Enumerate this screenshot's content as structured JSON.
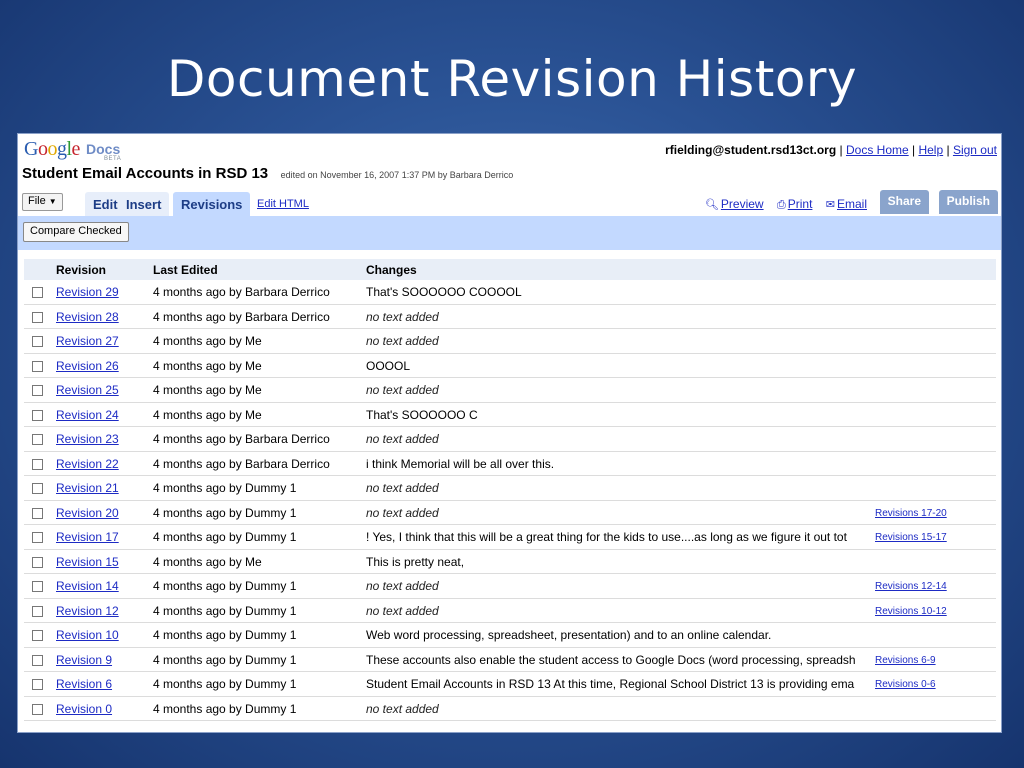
{
  "slide": {
    "title": "Document Revision History"
  },
  "app": {
    "logo_text": "Google",
    "logo_sub": "Docs",
    "logo_beta": "BETA",
    "account_email": "rfielding@student.rsd13ct.org",
    "links": [
      "Docs Home",
      "Help",
      "Sign out"
    ]
  },
  "document": {
    "title": "Student Email Accounts in RSD 13",
    "edited": "edited on November 16, 2007 1:37 PM by Barbara Derrico"
  },
  "tabs": {
    "file": "File",
    "edit": "Edit",
    "insert": "Insert",
    "revisions": "Revisions",
    "edit_html": "Edit HTML",
    "preview": "Preview",
    "print": "Print",
    "email": "Email",
    "share": "Share",
    "publish": "Publish"
  },
  "toolbar": {
    "compare": "Compare Checked"
  },
  "table": {
    "headers": [
      "Revision",
      "Last Edited",
      "Changes"
    ],
    "rows": [
      {
        "revision": "Revision 29",
        "edited": "4 months ago by Barbara Derrico",
        "changes": "That's SOOOOOO COOOOL",
        "range": ""
      },
      {
        "revision": "Revision 28",
        "edited": "4 months ago by Barbara Derrico",
        "changes": "no text added",
        "range": ""
      },
      {
        "revision": "Revision 27",
        "edited": "4 months ago by Me",
        "changes": "no text added",
        "range": ""
      },
      {
        "revision": "Revision 26",
        "edited": "4 months ago by Me",
        "changes": "OOOOL",
        "range": ""
      },
      {
        "revision": "Revision 25",
        "edited": "4 months ago by Me",
        "changes": "no text added",
        "range": ""
      },
      {
        "revision": "Revision 24",
        "edited": "4 months ago by Me",
        "changes": "That's SOOOOOO C",
        "range": ""
      },
      {
        "revision": "Revision 23",
        "edited": "4 months ago by Barbara Derrico",
        "changes": "no text added",
        "range": ""
      },
      {
        "revision": "Revision 22",
        "edited": "4 months ago by Barbara Derrico",
        "changes": "i think Memorial will be all over this.",
        "range": ""
      },
      {
        "revision": "Revision 21",
        "edited": "4 months ago by Dummy 1",
        "changes": "no text added",
        "range": ""
      },
      {
        "revision": "Revision 20",
        "edited": "4 months ago by Dummy 1",
        "changes": "no text added",
        "range": "Revisions 17-20"
      },
      {
        "revision": "Revision 17",
        "edited": "4 months ago by Dummy 1",
        "changes": "! Yes, I think that this will be a great thing for the kids to use....as long as we figure it out tot",
        "range": "Revisions 15-17"
      },
      {
        "revision": "Revision 15",
        "edited": "4 months ago by Me",
        "changes": "This is pretty neat,",
        "range": ""
      },
      {
        "revision": "Revision 14",
        "edited": "4 months ago by Dummy 1",
        "changes": "no text added",
        "range": "Revisions 12-14"
      },
      {
        "revision": "Revision 12",
        "edited": "4 months ago by Dummy 1",
        "changes": "no text added",
        "range": "Revisions 10-12"
      },
      {
        "revision": "Revision 10",
        "edited": "4 months ago by Dummy 1",
        "changes": "Web word processing, spreadsheet, presentation) and to an online calendar.",
        "range": ""
      },
      {
        "revision": "Revision 9",
        "edited": "4 months ago by Dummy 1",
        "changes": "These accounts also enable the student access to Google Docs (word processing, spreadsh",
        "range": "Revisions 6-9"
      },
      {
        "revision": "Revision 6",
        "edited": "4 months ago by Dummy 1",
        "changes": "Student Email Accounts in RSD 13 At this time, Regional School District 13 is providing ema",
        "range": "Revisions 0-6"
      },
      {
        "revision": "Revision 0",
        "edited": "4 months ago by Dummy 1",
        "changes": "no text added",
        "range": ""
      }
    ]
  }
}
